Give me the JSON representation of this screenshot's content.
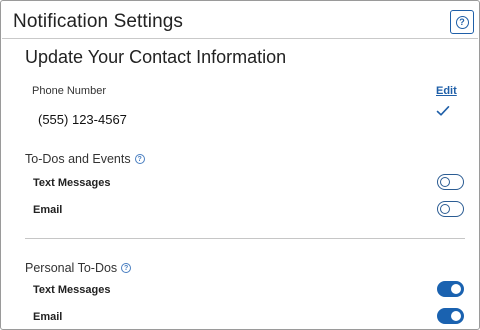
{
  "header": {
    "title": "Notification Settings",
    "help_icon": "question-circle-icon"
  },
  "contact": {
    "heading": "Update Your Contact Information",
    "phone_label": "Phone Number",
    "phone_value": "(555) 123-4567",
    "edit_label": "Edit",
    "verified_icon": "checkmark-icon"
  },
  "sections": [
    {
      "title": "To-Dos and Events",
      "rows": [
        {
          "label": "Text Messages",
          "enabled": false
        },
        {
          "label": "Email",
          "enabled": false
        }
      ]
    },
    {
      "title": "Personal To-Dos",
      "rows": [
        {
          "label": "Text Messages",
          "enabled": true
        },
        {
          "label": "Email",
          "enabled": true
        }
      ]
    }
  ],
  "colors": {
    "accent": "#1a62b0",
    "link": "#1f5fa8"
  }
}
